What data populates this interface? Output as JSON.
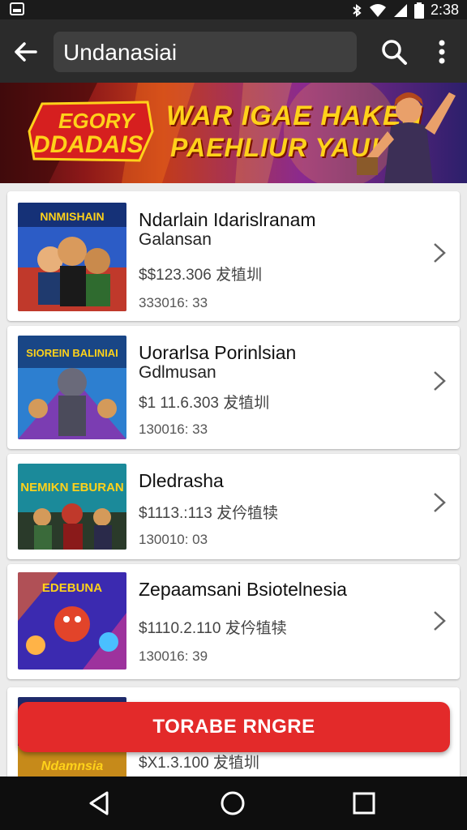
{
  "status_bar": {
    "time": "2:38"
  },
  "app_bar": {
    "search_value": "Undanasiai"
  },
  "banner": {
    "logo_line1": "EGORY",
    "logo_line2": "DDADAIS",
    "headline_line1": "WAR IGAE HAKEN",
    "headline_line2": "PAEHLIUR YAU!"
  },
  "list": {
    "items": [
      {
        "thumb_text": "NNMISHAIN",
        "title": "Ndarlain Idarislranam",
        "subtitle": "Galansan",
        "price": "$$123.306 犮犆圳",
        "meta": "333016: 33"
      },
      {
        "thumb_text": "SIOREIN BALINIAI",
        "title": "Uorarlsa Porinlsian",
        "subtitle": "Gdlmusan",
        "price": "$1 11.6.303 犮犆圳",
        "meta": "130016: 33"
      },
      {
        "thumb_text": "NEMIKN EBURAN",
        "title": "Dledrasha",
        "subtitle": "",
        "price": "$1113.:113 犮仱犆犊",
        "meta": "130010: 03"
      },
      {
        "thumb_text": "EDEBUNA",
        "title": "Zepaamsani Bsiotelnesia",
        "subtitle": "",
        "price": "$1110.2.110 犮仱犆犊",
        "meta": "130016: 39"
      },
      {
        "thumb_text": "Ndamnsia",
        "title": "",
        "subtitle": "",
        "price": "$X1.3.100 犮犆圳",
        "meta": ""
      }
    ]
  },
  "fab": {
    "label": "TORABE RNGRE"
  },
  "colors": {
    "accent": "#e32a2a",
    "app_bar": "#2b2b2b",
    "banner_text": "#ffd21a"
  }
}
